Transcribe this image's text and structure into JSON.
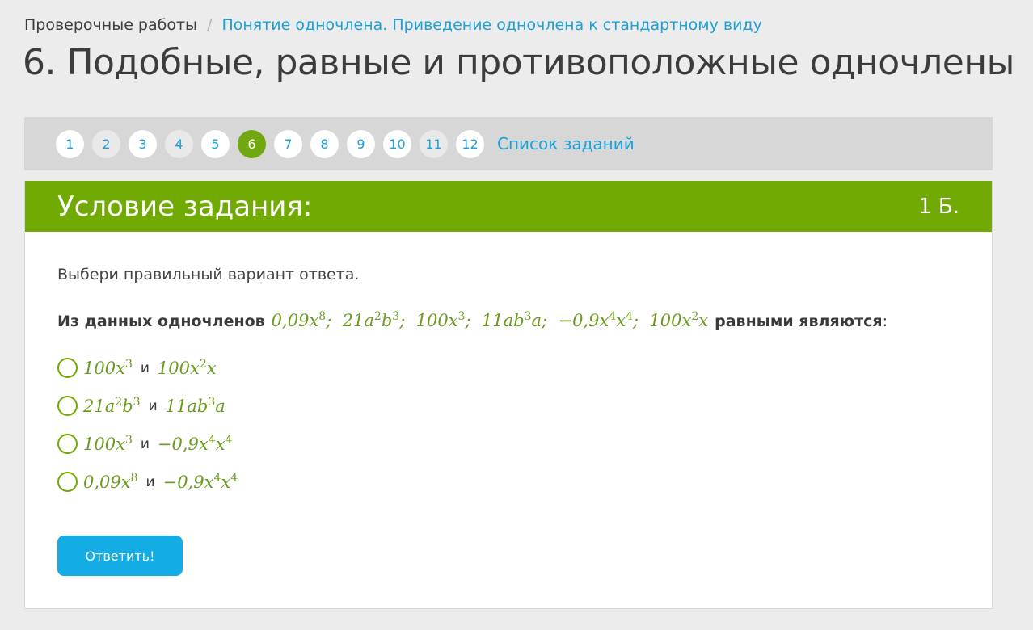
{
  "breadcrumb": {
    "root": "Проверочные работы",
    "separator": "/",
    "current": "Понятие одночлена. Приведение одночлена к стандартному виду"
  },
  "page_title": "6. Подобные, равные и противоположные одночлены",
  "pager": {
    "items": [
      {
        "label": "1",
        "state": "default"
      },
      {
        "label": "2",
        "state": "seen"
      },
      {
        "label": "3",
        "state": "default"
      },
      {
        "label": "4",
        "state": "seen"
      },
      {
        "label": "5",
        "state": "default"
      },
      {
        "label": "6",
        "state": "active"
      },
      {
        "label": "7",
        "state": "default"
      },
      {
        "label": "8",
        "state": "default"
      },
      {
        "label": "9",
        "state": "default"
      },
      {
        "label": "10",
        "state": "default"
      },
      {
        "label": "11",
        "state": "seen"
      },
      {
        "label": "12",
        "state": "default"
      }
    ],
    "task_list_label": "Список заданий"
  },
  "task": {
    "header_title": "Условие задания:",
    "points": "1 Б.",
    "instruction": "Выбери правильный вариант ответа.",
    "question_prefix": "Из данных одночленов",
    "question_suffix": "равными являются",
    "question_colon": ":",
    "options": [
      {
        "left": "100x3",
        "conj": "и",
        "right": "100x2x"
      },
      {
        "left": "21a2b3",
        "conj": "и",
        "right": "11ab3a"
      },
      {
        "left": "100x3",
        "conj": "и",
        "right": "−0,9x4x4"
      },
      {
        "left": "0,09x8",
        "conj": "и",
        "right": "−0,9x4x4"
      }
    ],
    "submit_label": "Ответить!"
  },
  "colors": {
    "accent_green": "#72aa04",
    "link_blue": "#1ba1d8",
    "button_blue": "#14ace4",
    "math_green": "#6a9c1e"
  }
}
